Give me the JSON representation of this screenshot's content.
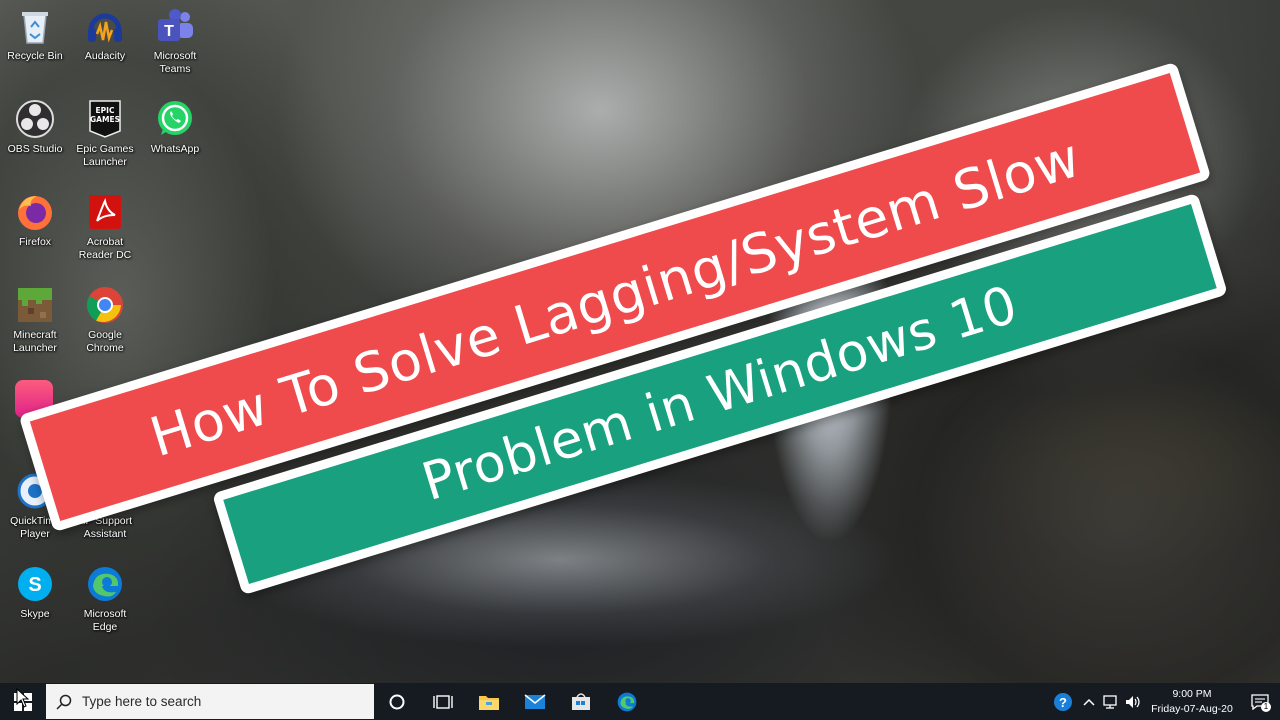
{
  "desktop": {
    "icons": [
      {
        "label": "Recycle Bin",
        "icon": "recycle-bin-icon"
      },
      {
        "label": "Audacity",
        "icon": "audacity-icon"
      },
      {
        "label": "Microsoft\nTeams",
        "icon": "teams-icon"
      },
      {
        "label": "OBS Studio",
        "icon": "obs-icon"
      },
      {
        "label": "Epic Games\nLauncher",
        "icon": "epic-games-icon",
        "logo_text": "EPIC\nGAMES"
      },
      {
        "label": "WhatsApp",
        "icon": "whatsapp-icon"
      },
      {
        "label": "Firefox",
        "icon": "firefox-icon"
      },
      {
        "label": "Acrobat\nReader DC",
        "icon": "acrobat-icon"
      },
      {
        "label": "Minecraft\nLauncher",
        "icon": "minecraft-icon"
      },
      {
        "label": "Google\nChrome",
        "icon": "chrome-icon"
      },
      {
        "label": "QuickTime\nPlayer",
        "icon": "quicktime-icon"
      },
      {
        "label": "HP Support\nAssistant",
        "icon": "hp-support-icon"
      },
      {
        "label": "Skype",
        "icon": "skype-icon"
      },
      {
        "label": "Microsoft\nEdge",
        "icon": "edge-icon"
      }
    ]
  },
  "banner": {
    "line1": "How To Solve Lagging/System Slow",
    "line2": "Problem in Windows 10",
    "colors": {
      "red": "#ef4a4c",
      "green": "#19a07e",
      "border": "#ffffff"
    }
  },
  "taskbar": {
    "search_placeholder": "Type here to search",
    "pinned": [
      "cortana-icon",
      "task-view-icon",
      "file-explorer-icon",
      "mail-icon",
      "store-icon",
      "edge-icon"
    ],
    "tray": {
      "time": "9:00 PM",
      "date": "Friday-07-Aug-20",
      "notification_count": "1"
    }
  }
}
